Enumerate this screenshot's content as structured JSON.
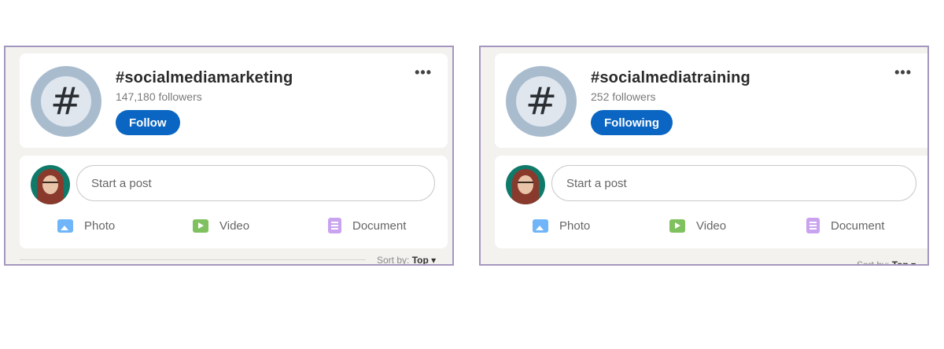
{
  "panels": [
    {
      "hashtag": "#socialmediamarketing",
      "followers": "147,180 followers",
      "button_label": "Follow",
      "more_label": "•••",
      "hash_symbol": "#",
      "post_placeholder": "Start a post",
      "actions": {
        "photo": "Photo",
        "video": "Video",
        "document": "Document"
      },
      "sort_label": "Sort by:",
      "sort_value": "Top ▾"
    },
    {
      "hashtag": "#socialmediatraining",
      "followers": "252 followers",
      "button_label": "Following",
      "more_label": "•••",
      "hash_symbol": "#",
      "post_placeholder": "Start a post",
      "actions": {
        "photo": "Photo",
        "video": "Video",
        "document": "Document"
      },
      "sort_label": "Sort by:",
      "sort_value": "Top ▾"
    }
  ],
  "colors": {
    "accent": "#0a66c2",
    "panel_border": "#a497bf",
    "photo_icon": "#70b5f9",
    "video_icon": "#7fc15e",
    "document_icon": "#c9a3f0"
  }
}
